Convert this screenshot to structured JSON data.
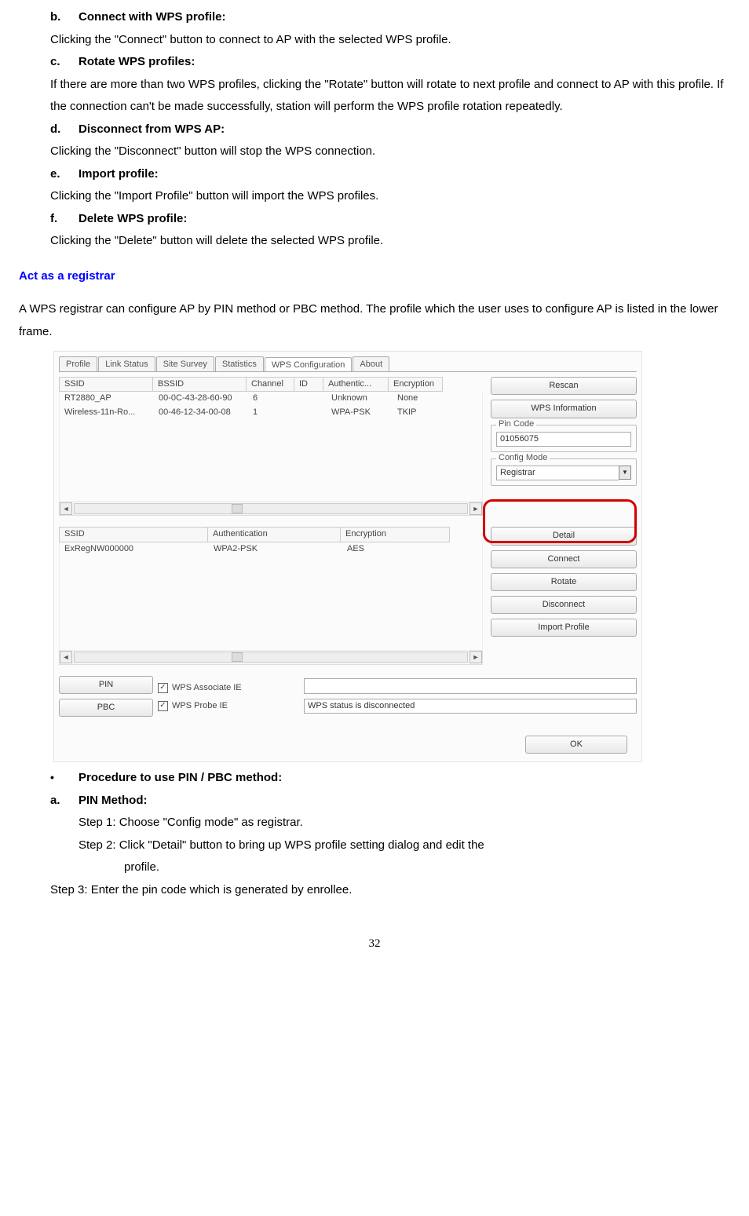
{
  "sections": {
    "b": {
      "title": "Connect with WPS profile:",
      "text": "Clicking the \"Connect\" button to connect to AP with the selected WPS profile."
    },
    "c": {
      "title": "Rotate WPS profiles:",
      "text": "If there are more than two WPS profiles, clicking the \"Rotate\" button will rotate to next profile and connect to AP with this profile. If the connection can't be made successfully, station will perform the WPS profile rotation repeatedly."
    },
    "d": {
      "title": "Disconnect from WPS AP:",
      "text": "Clicking the \"Disconnect\" button will stop the WPS connection."
    },
    "e": {
      "title": "Import profile:",
      "text": "Clicking the \"Import Profile\" button will import the WPS profiles."
    },
    "f": {
      "title": "Delete WPS profile:",
      "text": "Clicking the \"Delete\" button will delete the selected WPS profile."
    }
  },
  "blue_heading": "Act as a registrar",
  "registrar_intro": "A WPS registrar can configure AP by PIN method or PBC method. The profile which the user uses to configure AP is listed in the lower frame.",
  "screenshot": {
    "tabs": [
      "Profile",
      "Link Status",
      "Site Survey",
      "Statistics",
      "WPS Configuration",
      "About"
    ],
    "active_tab_index": 4,
    "ap_table": {
      "headers": [
        "SSID",
        "BSSID",
        "Channel",
        "ID",
        "Authentic...",
        "Encryption"
      ],
      "rows": [
        {
          "ssid": "RT2880_AP",
          "bssid": "00-0C-43-28-60-90",
          "channel": "6",
          "id": "",
          "auth": "Unknown",
          "enc": "None"
        },
        {
          "ssid": "Wireless-11n-Ro...",
          "bssid": "00-46-12-34-00-08",
          "channel": "1",
          "id": "",
          "auth": "WPA-PSK",
          "enc": "TKIP"
        }
      ]
    },
    "buttons": {
      "rescan": "Rescan",
      "wps_info": "WPS Information"
    },
    "pin_code": {
      "label": "Pin Code",
      "value": "01056075"
    },
    "config_mode": {
      "label": "Config Mode",
      "value": "Registrar"
    },
    "profile_table": {
      "headers": [
        "SSID",
        "Authentication",
        "Encryption"
      ],
      "rows": [
        {
          "ssid": "ExRegNW000000",
          "auth": "WPA2-PSK",
          "enc": "AES"
        }
      ]
    },
    "profile_buttons": [
      "Detail",
      "Connect",
      "Rotate",
      "Disconnect",
      "Import Profile"
    ],
    "bottom": {
      "pin_btn": "PIN",
      "pbc_btn": "PBC",
      "chk1": "WPS Associate IE",
      "chk2": "WPS Probe IE",
      "status_empty": "",
      "status_text": "WPS status is disconnected",
      "ok": "OK"
    }
  },
  "procedure_heading": "Procedure to use PIN / PBC method:",
  "pin_method": {
    "title": "PIN Method:",
    "step1": "Step 1: Choose \"Config mode\" as registrar.",
    "step2_line1": "Step 2: Click \"Detail\" button to bring up WPS profile setting dialog and edit the",
    "step2_line2": "profile.",
    "step3": "Step 3: Enter the pin code which is generated by enrollee."
  },
  "page_number": "32"
}
